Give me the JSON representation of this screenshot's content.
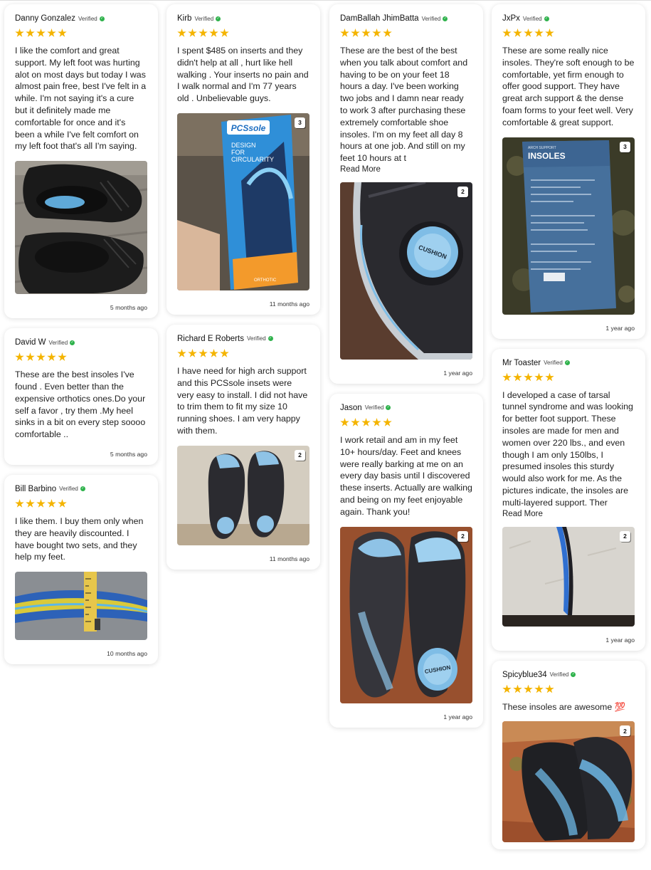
{
  "verified_label": "Verified",
  "read_more_label": "Read More",
  "reviews": {
    "danny": {
      "name": "Danny Gonzalez",
      "rating": 5,
      "text": "I like the comfort and great support. My left foot was hurting alot on most days but today I was almost pain free, best I've felt in a while. I'm not saying it's a cure but it definitely made me comfortable for once and it's been a while I've felt comfort on my left foot that's all I'm saying.",
      "date": "5 months ago"
    },
    "david": {
      "name": "David W",
      "rating": 5,
      "text": "These are the best insoles I've found . Even better than the expensive orthotics ones.Do your self a favor , try them .My heel sinks in a bit on every step soooo comfortable ..",
      "date": "5 months ago"
    },
    "bill": {
      "name": "Bill Barbino",
      "rating": 5,
      "text": "I like them. I buy them only when they are heavily discounted. I have bought two sets, and they help my feet.",
      "date": "10 months ago"
    },
    "kirb": {
      "name": "Kirb",
      "rating": 5,
      "text": "I spent $485 on inserts and they didn't help at all , hurt like hell walking . Your inserts no pain and I walk normal and I'm 77 years old . Unbelievable guys.",
      "photo_count": "3",
      "box_text": {
        "brand": "PCSsole",
        "line1": "DESIGN",
        "line2": "FOR",
        "line3": "CIRCULARITY",
        "footer": "ORTHOTIC"
      },
      "date": "11 months ago"
    },
    "richard": {
      "name": "Richard E Roberts",
      "rating": 5,
      "text": "I have need for high arch support and this PCSsole insets were very easy to install. I did not have to trim them to fit my size 10 running shoes. I am very happy with them.",
      "photo_count": "2",
      "date": "11 months ago"
    },
    "damballah": {
      "name": "DamBallah JhimBatta",
      "rating": 5,
      "text": "These are the best of the best when you talk about comfort and having to be on your feet 18 hours a day. I've been working two jobs and I damn near ready to work 3 after purchasing these extremely comfortable shoe insoles. I'm on my feet all day 8 hours at one job. And still on my feet 10 hours at t",
      "photo_count": "2",
      "heel_text": "CUSHION",
      "date": "1 year ago"
    },
    "jason": {
      "name": "Jason",
      "rating": 5,
      "text": "I work retail and am in my feet 10+ hours/day. Feet and knees were really barking at me on an every day basis until I discovered these inserts. Actually are walking and being on my feet enjoyable again. Thank you!",
      "photo_count": "2",
      "heel_text": "CUSHION",
      "date": "1 year ago"
    },
    "jxpx": {
      "name": "JxPx",
      "rating": 5,
      "text": "These are some really nice insoles. They're soft enough to be comfortable, yet firm enough to offer good support. They have great arch support & the dense foam forms to your feet well. Very comfortable & great support.",
      "photo_count": "3",
      "box_text": {
        "small": "ARCH SUPPORT",
        "title": "INSOLES"
      },
      "date": "1 year ago"
    },
    "mrtoaster": {
      "name": "Mr Toaster",
      "rating": 5,
      "text": "I developed a case of tarsal tunnel syndrome and was looking for better foot support. These insoles are made for men and women over 220 lbs., and even though I am only 150lbs, I presumed insoles this sturdy would also work for me. As the pictures indicate, the insoles are multi-layered support. Ther",
      "photo_count": "2",
      "date": "1 year ago"
    },
    "spicy": {
      "name": "Spicyblue34",
      "rating": 5,
      "text": "These insoles are awesome 💯",
      "photo_count": "2"
    }
  },
  "colors": {
    "star": "#f4b400",
    "verified_check": "#2fb24c"
  }
}
